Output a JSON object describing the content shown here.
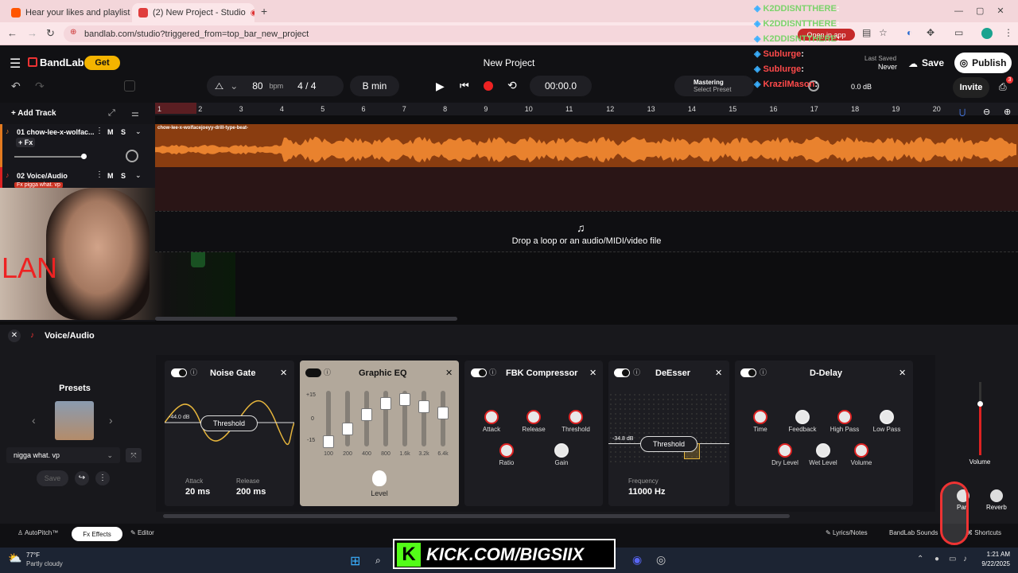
{
  "browser": {
    "tabs": [
      {
        "title": "Hear your likes and playlists, an",
        "active": false
      },
      {
        "title": "(2) New Project - Studio",
        "active": true
      }
    ],
    "url": "bandlab.com/studio?triggered_from=top_bar_new_project",
    "open_in_app": "Open in app"
  },
  "app": {
    "brand": "BandLab",
    "get_label": "Get",
    "project_title": "New Project",
    "last_saved_label": "Last Saved",
    "last_saved_value": "Never",
    "save_label": "Save",
    "publish_label": "Publish",
    "invite_label": "Invite",
    "invite_badge": "3"
  },
  "toolbar": {
    "bpm_value": "80",
    "bpm_unit": "bpm",
    "time_sig": "4 / 4",
    "key": "B min",
    "time": "00:00.0",
    "mastering_label": "Mastering",
    "select_preset": "Select Preset",
    "volume_db": "0.0 dB"
  },
  "tracks": {
    "add_track": "Add Track",
    "items": [
      {
        "name": "01  chow-lee-x-wolfac...",
        "m": "M",
        "s": "S",
        "fx": "+ Fx"
      },
      {
        "name": "02  Voice/Audio",
        "m": "M",
        "s": "S",
        "region": "Fx pigga what. vp"
      }
    ],
    "clip_name": "chow-lee-x-wolfacejoeyy-drill-type-beat-",
    "ruler": [
      "1",
      "2",
      "3",
      "4",
      "5",
      "6",
      "7",
      "8",
      "9",
      "10",
      "11",
      "12",
      "13",
      "14",
      "15",
      "16",
      "17",
      "18",
      "19",
      "20"
    ],
    "drop_text": "Drop a loop or an audio/MIDI/video file"
  },
  "overlay_text": "LAN",
  "chat": [
    {
      "user": "K2DDISNTTHERE",
      "msg": ":",
      "color": "#7bd36b"
    },
    {
      "user": "K2DDISNTTHERE",
      "msg": ":",
      "color": "#7bd36b"
    },
    {
      "user": "K2DDISNTTHERE",
      "msg": ":",
      "color": "#7bd36b"
    },
    {
      "user": "Sublurge",
      "msg": ":",
      "color": "#ff4a4a"
    },
    {
      "user": "Sublurge",
      "msg": ":",
      "color": "#ff4a4a"
    },
    {
      "user": "KrazilMason",
      "msg": ":",
      "color": "#ff4a4a"
    }
  ],
  "fxpanel": {
    "title": "Voice/Audio",
    "presets_label": "Presets",
    "preset_name": "nigga what. vp",
    "save_label": "Save",
    "noise_gate": {
      "title": "Noise Gate",
      "db": "-44.0 dB",
      "threshold": "Threshold",
      "attack_label": "Attack",
      "attack": "20 ms",
      "release_label": "Release",
      "release": "200 ms"
    },
    "graphic_eq": {
      "title": "Graphic EQ",
      "scale": [
        "+15",
        "0",
        "-15"
      ],
      "bands": [
        "100",
        "200",
        "400",
        "800",
        "1.6k",
        "3.2k",
        "6.4k"
      ],
      "level": "Level"
    },
    "compressor": {
      "title": "FBK Compressor",
      "knobs": [
        "Attack",
        "Release",
        "Threshold",
        "Ratio",
        "Gain"
      ]
    },
    "deesser": {
      "title": "DeEsser",
      "db": "-34.8 dB",
      "threshold": "Threshold",
      "freq_label": "Frequency",
      "freq": "11000 Hz"
    },
    "delay": {
      "title": "D-Delay",
      "knobs": [
        "Time",
        "Feedback",
        "High Pass",
        "Low Pass",
        "Dry Level",
        "Wet Level",
        "Volume"
      ]
    },
    "volume_label": "Volume",
    "pan_label": "Pan",
    "reverb_label": "Reverb"
  },
  "bottombar": {
    "autopitch": "AutoPitch™",
    "effects": "Fx Effects",
    "editor": "Editor",
    "lyrics": "Lyrics/Notes",
    "sounds": "BandLab Sounds",
    "shortcuts": "Shortcuts"
  },
  "taskbar": {
    "temp": "77°F",
    "weather": "Partly cloudy",
    "time": "1:21 AM",
    "date": "9/22/2025",
    "stream": "KICK.COM/BIGSIIX"
  }
}
